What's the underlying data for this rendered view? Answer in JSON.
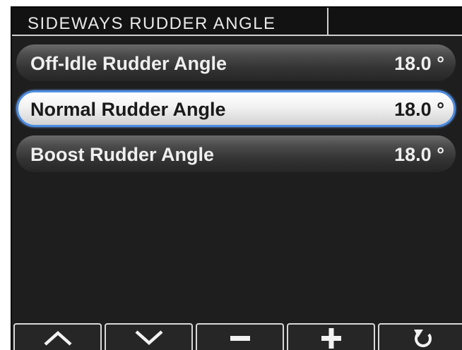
{
  "header": {
    "title": "SIDEWAYS RUDDER ANGLE"
  },
  "menu": {
    "items": [
      {
        "label": "Off-Idle Rudder Angle",
        "value": "18.0 °",
        "selected": false
      },
      {
        "label": "Normal Rudder Angle",
        "value": "18.0 °",
        "selected": true
      },
      {
        "label": "Boost Rudder Angle",
        "value": "18.0 °",
        "selected": false
      }
    ]
  },
  "softkeys": [
    {
      "icon": "chevron-up-icon"
    },
    {
      "icon": "chevron-down-icon"
    },
    {
      "icon": "minus-icon"
    },
    {
      "icon": "plus-icon"
    },
    {
      "icon": "back-arrow-icon"
    }
  ],
  "colors": {
    "background": "#1e1e1e",
    "selection_border": "#4e8de0",
    "text_light": "#efefef",
    "text_dark": "#1a1a1a"
  }
}
